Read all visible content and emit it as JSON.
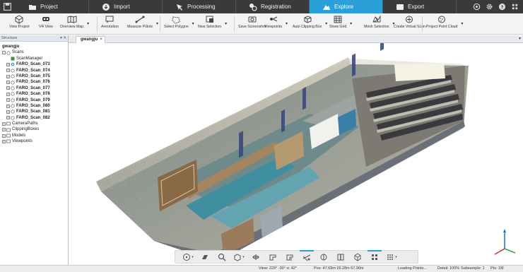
{
  "topbar": {
    "tabs": [
      {
        "label": "Project",
        "icon": "folder-icon"
      },
      {
        "label": "Import",
        "icon": "import-icon"
      },
      {
        "label": "Processing",
        "icon": "processing-icon"
      },
      {
        "label": "Registration",
        "icon": "registration-icon"
      },
      {
        "label": "Explore",
        "icon": "explore-icon",
        "active": true
      },
      {
        "label": "Export",
        "icon": "export-icon"
      }
    ],
    "accent": "#2a9fd8"
  },
  "ribbon": {
    "buttons": [
      {
        "label": "View Project",
        "icon": "cube-view-icon"
      },
      {
        "label": "VR View",
        "icon": "vr-headset-icon"
      },
      {
        "label": "Overview Map",
        "icon": "map-icon"
      },
      {
        "label": "Annotation",
        "icon": "annotation-icon"
      },
      {
        "label": "Measure Points",
        "icon": "measure-icon"
      },
      {
        "label": "Select Polygon",
        "icon": "polygon-icon"
      },
      {
        "label": "New Selection",
        "icon": "selection-icon"
      },
      {
        "label": "Save Screenshot",
        "icon": "camera-icon"
      },
      {
        "label": "Viewpoints",
        "icon": "viewpoints-icon"
      },
      {
        "label": "Auto Clipping Box",
        "icon": "clipping-box-icon"
      },
      {
        "label": "Show Grid",
        "icon": "grid-icon"
      },
      {
        "label": "Mesh Selection",
        "icon": "mesh-icon"
      },
      {
        "label": "Create Virtual Scan",
        "icon": "virtual-scan-icon"
      },
      {
        "label": "Project Point Cloud",
        "icon": "point-cloud-icon"
      }
    ]
  },
  "structure": {
    "header": "Structure",
    "root": "gwangju",
    "scans_label": "Scans",
    "scan_manager": "ScanManager",
    "scans": [
      "FARO_Scan_073",
      "FARO_Scan_074",
      "FARO_Scan_075",
      "FARO_Scan_076",
      "FARO_Scan_077",
      "FARO_Scan_078",
      "FARO_Scan_079",
      "FARO_Scan_080",
      "FARO_Scan_081",
      "FARO_Scan_082"
    ],
    "others": [
      "CameraPaths",
      "ClippingBoxes",
      "Models",
      "Viewpoints"
    ]
  },
  "document": {
    "tab_title": "gwangju",
    "close": "×",
    "menu": "▾"
  },
  "statusbar": {
    "view": "View: 229° -30° α: 42°",
    "pos": "Pos: 47.69m 26.28m 67.90m",
    "loading": "Loading Points...",
    "detail": "Detail: 100%",
    "subsample": "Subsample: 1",
    "pts": "Pts: 1M"
  }
}
